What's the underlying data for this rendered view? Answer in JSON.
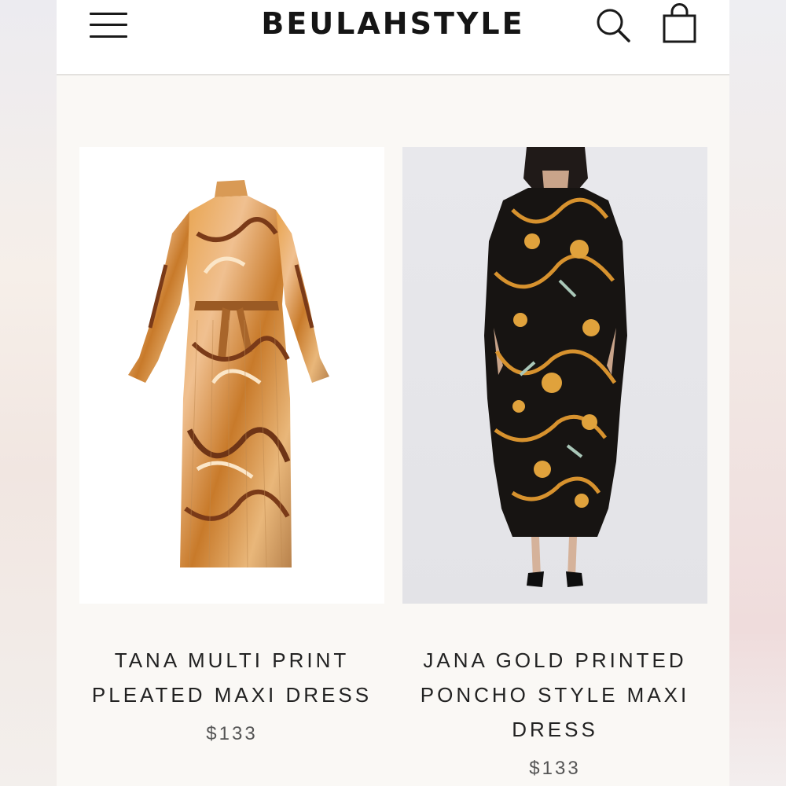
{
  "header": {
    "brand": "BEULAHSTYLE",
    "menu_icon": "hamburger-menu-icon",
    "search_icon": "search-icon",
    "bag_icon": "shopping-bag-icon"
  },
  "products": [
    {
      "title_line1": "TANA MULTI PRINT",
      "title_line2": "PLEATED MAXI DRESS",
      "title_line3": "",
      "price": "$133"
    },
    {
      "title_line1": "JANA GOLD PRINTED",
      "title_line2": "PONCHO STYLE MAXI",
      "title_line3": "DRESS",
      "price": "$133"
    }
  ]
}
